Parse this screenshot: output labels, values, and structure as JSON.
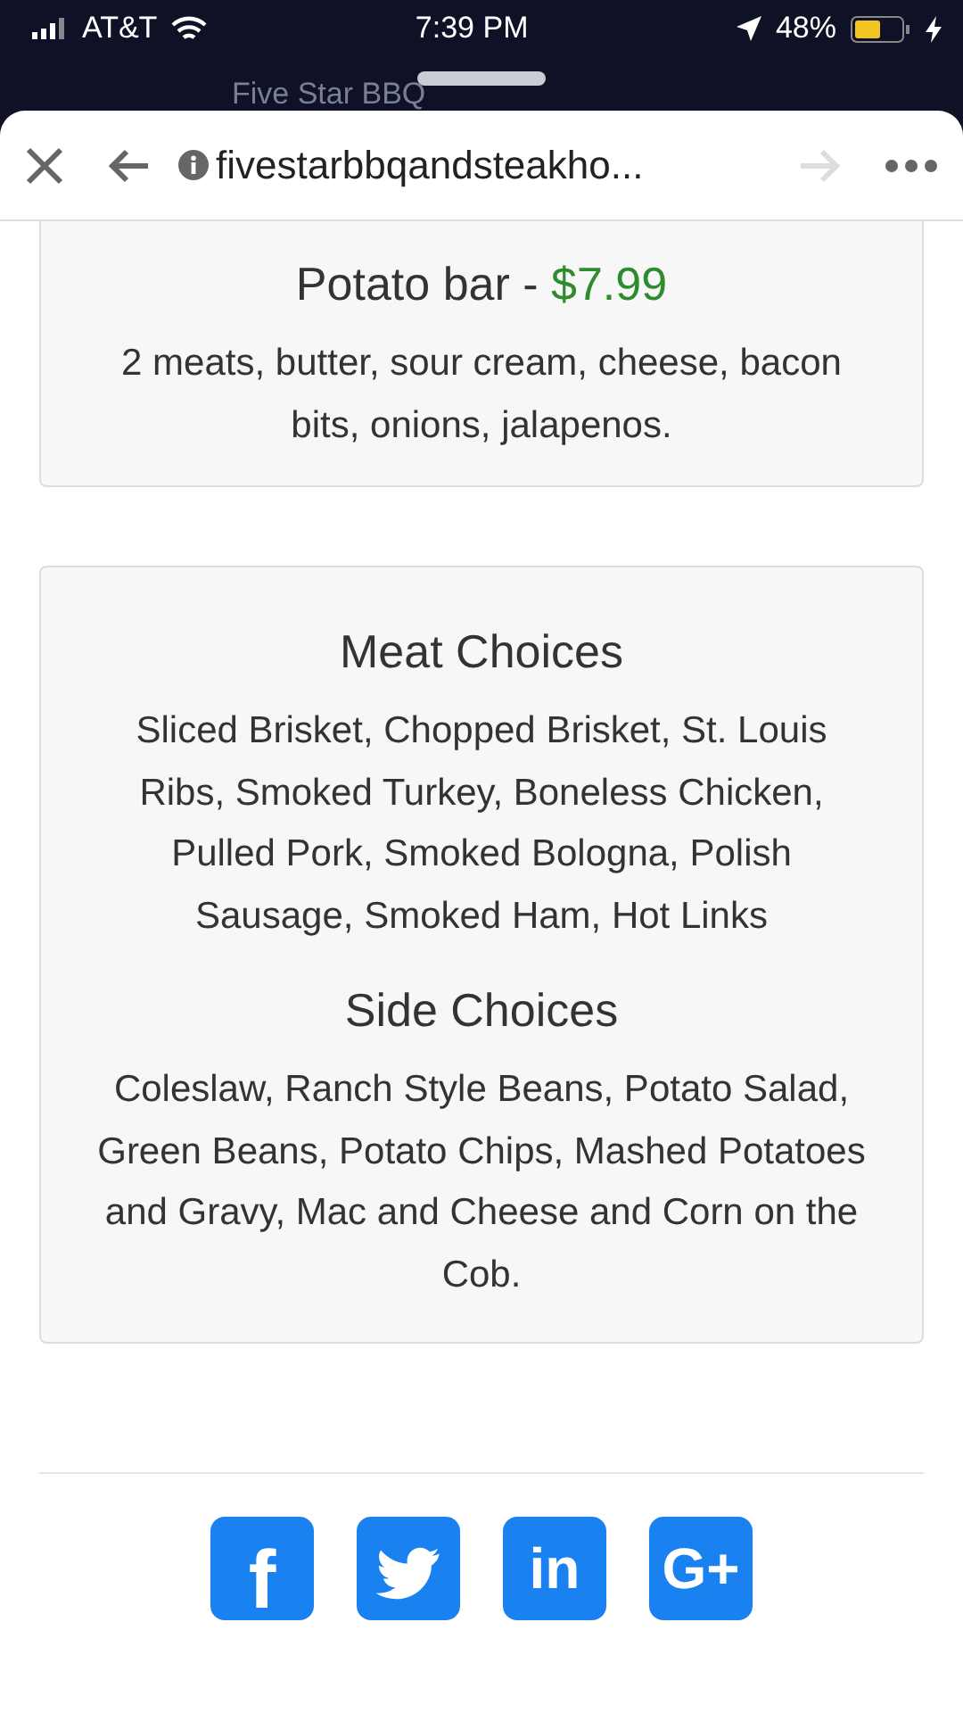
{
  "status_bar": {
    "carrier": "AT&T",
    "time": "7:39 PM",
    "battery": "48%"
  },
  "background_title": "Five Star BBQ",
  "browser": {
    "url": "fivestarbbqandsteakho...",
    "forward_disabled": true
  },
  "cards": [
    {
      "title": "Potato bar - ",
      "price": "$7.99",
      "text": "2 meats, butter, sour cream, cheese, bacon bits, onions, jalapenos."
    },
    {
      "sections": [
        {
          "title": "Meat Choices",
          "text": "Sliced Brisket, Chopped Brisket, St. Louis Ribs, Smoked Turkey, Boneless Chicken, Pulled Pork, Smoked Bologna, Polish Sausage, Smoked Ham, Hot Links"
        },
        {
          "title": "Side Choices",
          "text": "Coleslaw, Ranch Style Beans, Potato Salad, Green Beans, Potato Chips, Mashed Potatoes and Gravy, Mac and Cheese and Corn on the Cob."
        }
      ]
    }
  ],
  "social": [
    {
      "kind": "facebook",
      "glyph": "f"
    },
    {
      "kind": "twitter"
    },
    {
      "kind": "linkedin",
      "glyph": "in"
    },
    {
      "kind": "googleplus",
      "glyph": "G+"
    }
  ]
}
